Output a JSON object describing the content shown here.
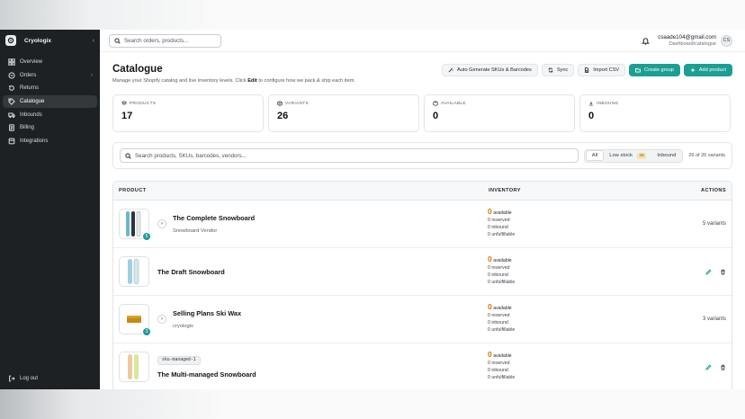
{
  "sidebar": {
    "brand": "Cryologix",
    "items": [
      {
        "label": "Overview"
      },
      {
        "label": "Orders"
      },
      {
        "label": "Returns"
      },
      {
        "label": "Catalogue"
      },
      {
        "label": "Inbounds"
      },
      {
        "label": "Billing"
      },
      {
        "label": "Integrations"
      }
    ],
    "logout": "Log out"
  },
  "topbar": {
    "search_placeholder": "Search orders, products...",
    "email": "csaade104@gmail.com",
    "path": "Dashboard/catalogue",
    "avatar": "CS"
  },
  "page": {
    "title": "Catalogue",
    "subtitle_before": "Manage your Shopify catalog and live inventory levels. Click",
    "subtitle_bold": "Edit",
    "subtitle_after": "to configure how we pack & ship each item."
  },
  "actions": {
    "auto_generate": "Auto Generate SKUs & Barcodes",
    "sync": "Sync",
    "import": "Import CSV",
    "create_group": "Create group",
    "add_product": "Add product"
  },
  "stats": [
    {
      "label": "PRODUCTS",
      "value": "17"
    },
    {
      "label": "VARIANTS",
      "value": "26"
    },
    {
      "label": "AVAILABLE",
      "value": "0"
    },
    {
      "label": "INBOUND",
      "value": "0"
    }
  ],
  "filters": {
    "search_placeholder": "Search products, SKUs, barcodes, vendors...",
    "all": "All",
    "low_stock": "Low stock",
    "low_stock_count": "26",
    "inbound": "Inbound",
    "count": "26 of 26 variants"
  },
  "table": {
    "headers": {
      "product": "PRODUCT",
      "inventory": "INVENTORY",
      "actions": "ACTIONS"
    },
    "rows": [
      {
        "name": "The Complete Snowboard",
        "vendor": "Snowboard Vendor",
        "badge": "6",
        "available": "0",
        "available_label": "available",
        "reserved": "0 reserved",
        "inbound": "0 inbound",
        "unfulfillable": "0 unfulfillable",
        "variants": "5 variants"
      },
      {
        "name": "The Draft Snowboard",
        "available": "0",
        "available_label": "available",
        "reserved": "0 reserved",
        "inbound": "0 inbound",
        "unfulfillable": "0 unfulfillable"
      },
      {
        "name": "Selling Plans Ski Wax",
        "vendor": "cryologix",
        "badge": "3",
        "available": "0",
        "available_label": "available",
        "reserved": "0 reserved",
        "inbound": "0 inbound",
        "unfulfillable": "0 unfulfillable",
        "variants": "3 variants"
      },
      {
        "name": "The Multi-managed Snowboard",
        "sku": "sku-managed-1",
        "available": "0",
        "available_label": "available",
        "reserved": "0 reserved",
        "inbound": "0 inbound",
        "unfulfillable": "0 unfulfillable"
      }
    ]
  }
}
